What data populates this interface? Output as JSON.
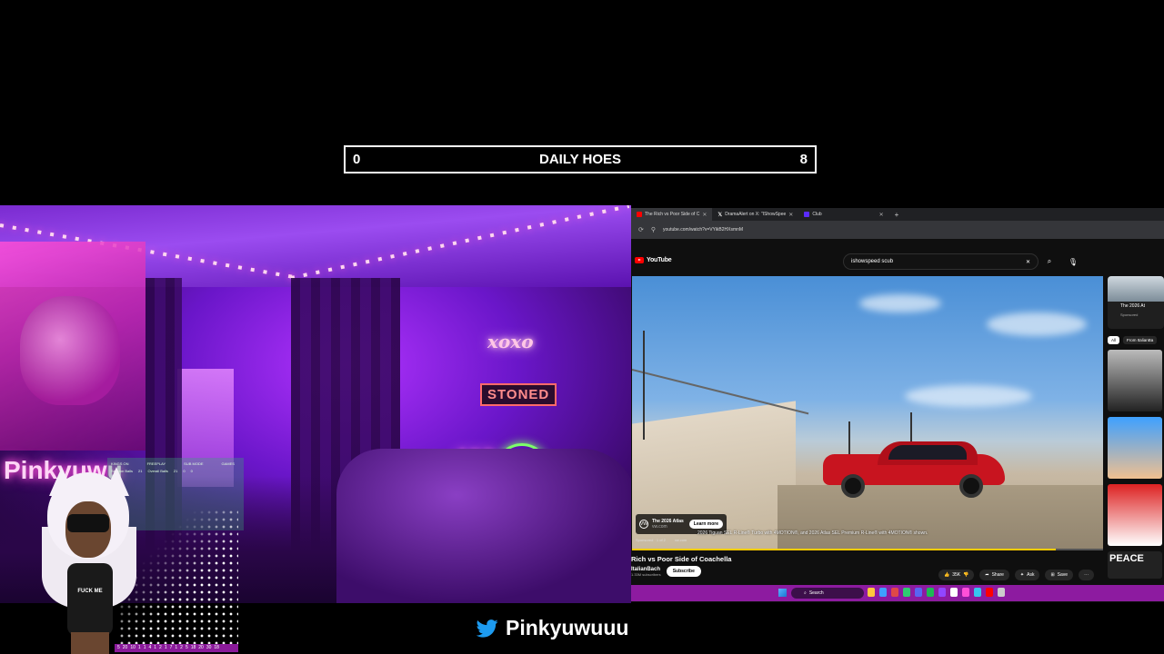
{
  "scoreboard": {
    "left_score": "0",
    "title": "DAILY HOES",
    "right_score": "8"
  },
  "webcam": {
    "neon_xoxo": "xoxo",
    "neon_stoned": "STONED",
    "neon_420": "420",
    "neon_name": "Pinkyuwu",
    "avatar_shirt": "FUCK ME",
    "mini_overlay": {
      "headers": [
        "KINGS ON",
        "FREEPLAY",
        "SUB MODE",
        "GAMES"
      ],
      "row": [
        "Session Balls",
        "21",
        "Overall Balls",
        "21",
        "0",
        "0"
      ]
    },
    "score_strip": [
      "5",
      "20",
      "10",
      "1",
      "1",
      "4",
      "1",
      "2",
      "1",
      "7",
      "1",
      "2",
      "5",
      "18",
      "20",
      "30",
      "18"
    ]
  },
  "browser": {
    "tabs": [
      {
        "label": "The Rich vs Poor Side of C",
        "color": "#ff0000",
        "active": true
      },
      {
        "label": "DramaAlert on X: \"IShowSpee",
        "color": "#ffffff",
        "active": false
      },
      {
        "label": "Club",
        "color": "#5a2bff",
        "active": false
      }
    ],
    "url": "youtube.com/watch?v=VYikB2HXsmnM",
    "yt_logo": "YouTube",
    "search_query": "ishowspeed scub",
    "video": {
      "ad_title": "The 2026 Atlas",
      "ad_domain": "vw.com",
      "ad_cta": "Learn more",
      "ad_meta": [
        "Sponsored · 1 of 2",
        "vw.com"
      ],
      "caption": "2026 Tiguan SEL R-Line® Turbo with 4MOTION®, and 2026 Atlas SEL Premium R-Line® with 4MOTION® shown.",
      "progress": 0.9
    },
    "title": "Rich vs Poor Side of Coachella",
    "channel": "ItalianBach",
    "subscribers": "1.33M subscribers",
    "subscribe_label": "Subscribe",
    "actions": {
      "likes": "35K",
      "share": "Share",
      "ask": "Ask",
      "save": "Save"
    },
    "sidebar": {
      "ad_title": "The 2026 At",
      "ad_sponsored": "Sponsored",
      "chips": [
        "All",
        "From ItalianBa"
      ],
      "peace_label": "PEACE"
    },
    "taskbar_search": "Search"
  },
  "social": {
    "twitter_handle": "Pinkyuwuuu"
  },
  "colors": {
    "taskbar": "#8d1ba0",
    "accent_red": "#ff0000",
    "twitter_blue": "#1d9bf0"
  }
}
